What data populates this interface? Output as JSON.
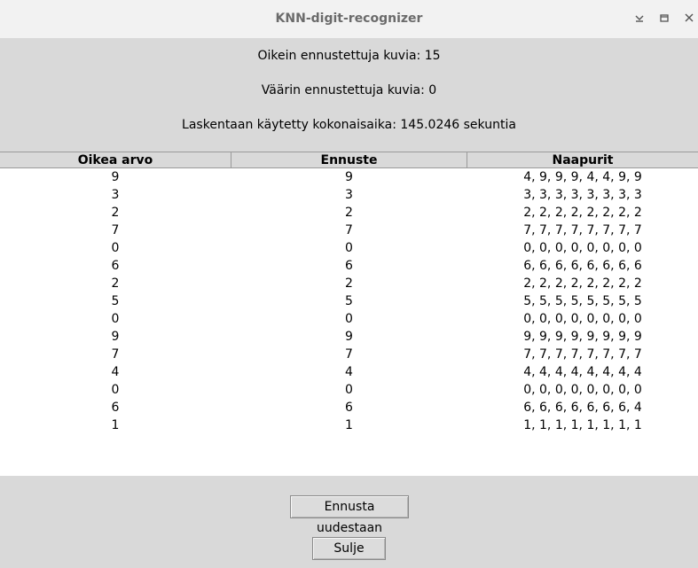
{
  "window": {
    "title": "KNN-digit-recognizer"
  },
  "summary": {
    "correct": "Oikein ennustettuja kuvia: 15",
    "wrong": "Väärin ennustettuja kuvia: 0",
    "time": "Laskentaan käytetty kokonaisaika: 145.0246 sekuntia"
  },
  "table": {
    "headers": [
      "Oikea arvo",
      "Ennuste",
      "Naapurit"
    ],
    "rows": [
      [
        "9",
        "9",
        "4, 9, 9, 9, 4, 4, 9, 9"
      ],
      [
        "3",
        "3",
        "3, 3, 3, 3, 3, 3, 3, 3"
      ],
      [
        "2",
        "2",
        "2, 2, 2, 2, 2, 2, 2, 2"
      ],
      [
        "7",
        "7",
        "7, 7, 7, 7, 7, 7, 7, 7"
      ],
      [
        "0",
        "0",
        "0, 0, 0, 0, 0, 0, 0, 0"
      ],
      [
        "6",
        "6",
        "6, 6, 6, 6, 6, 6, 6, 6"
      ],
      [
        "2",
        "2",
        "2, 2, 2, 2, 2, 2, 2, 2"
      ],
      [
        "5",
        "5",
        "5, 5, 5, 5, 5, 5, 5, 5"
      ],
      [
        "0",
        "0",
        "0, 0, 0, 0, 0, 0, 0, 0"
      ],
      [
        "9",
        "9",
        "9, 9, 9, 9, 9, 9, 9, 9"
      ],
      [
        "7",
        "7",
        "7, 7, 7, 7, 7, 7, 7, 7"
      ],
      [
        "4",
        "4",
        "4, 4, 4, 4, 4, 4, 4, 4"
      ],
      [
        "0",
        "0",
        "0, 0, 0, 0, 0, 0, 0, 0"
      ],
      [
        "6",
        "6",
        "6, 6, 6, 6, 6, 6, 6, 4"
      ],
      [
        "1",
        "1",
        "1, 1, 1, 1, 1, 1, 1, 1"
      ]
    ]
  },
  "buttons": {
    "repredict": "Ennusta uudestaan",
    "close": "Sulje"
  }
}
